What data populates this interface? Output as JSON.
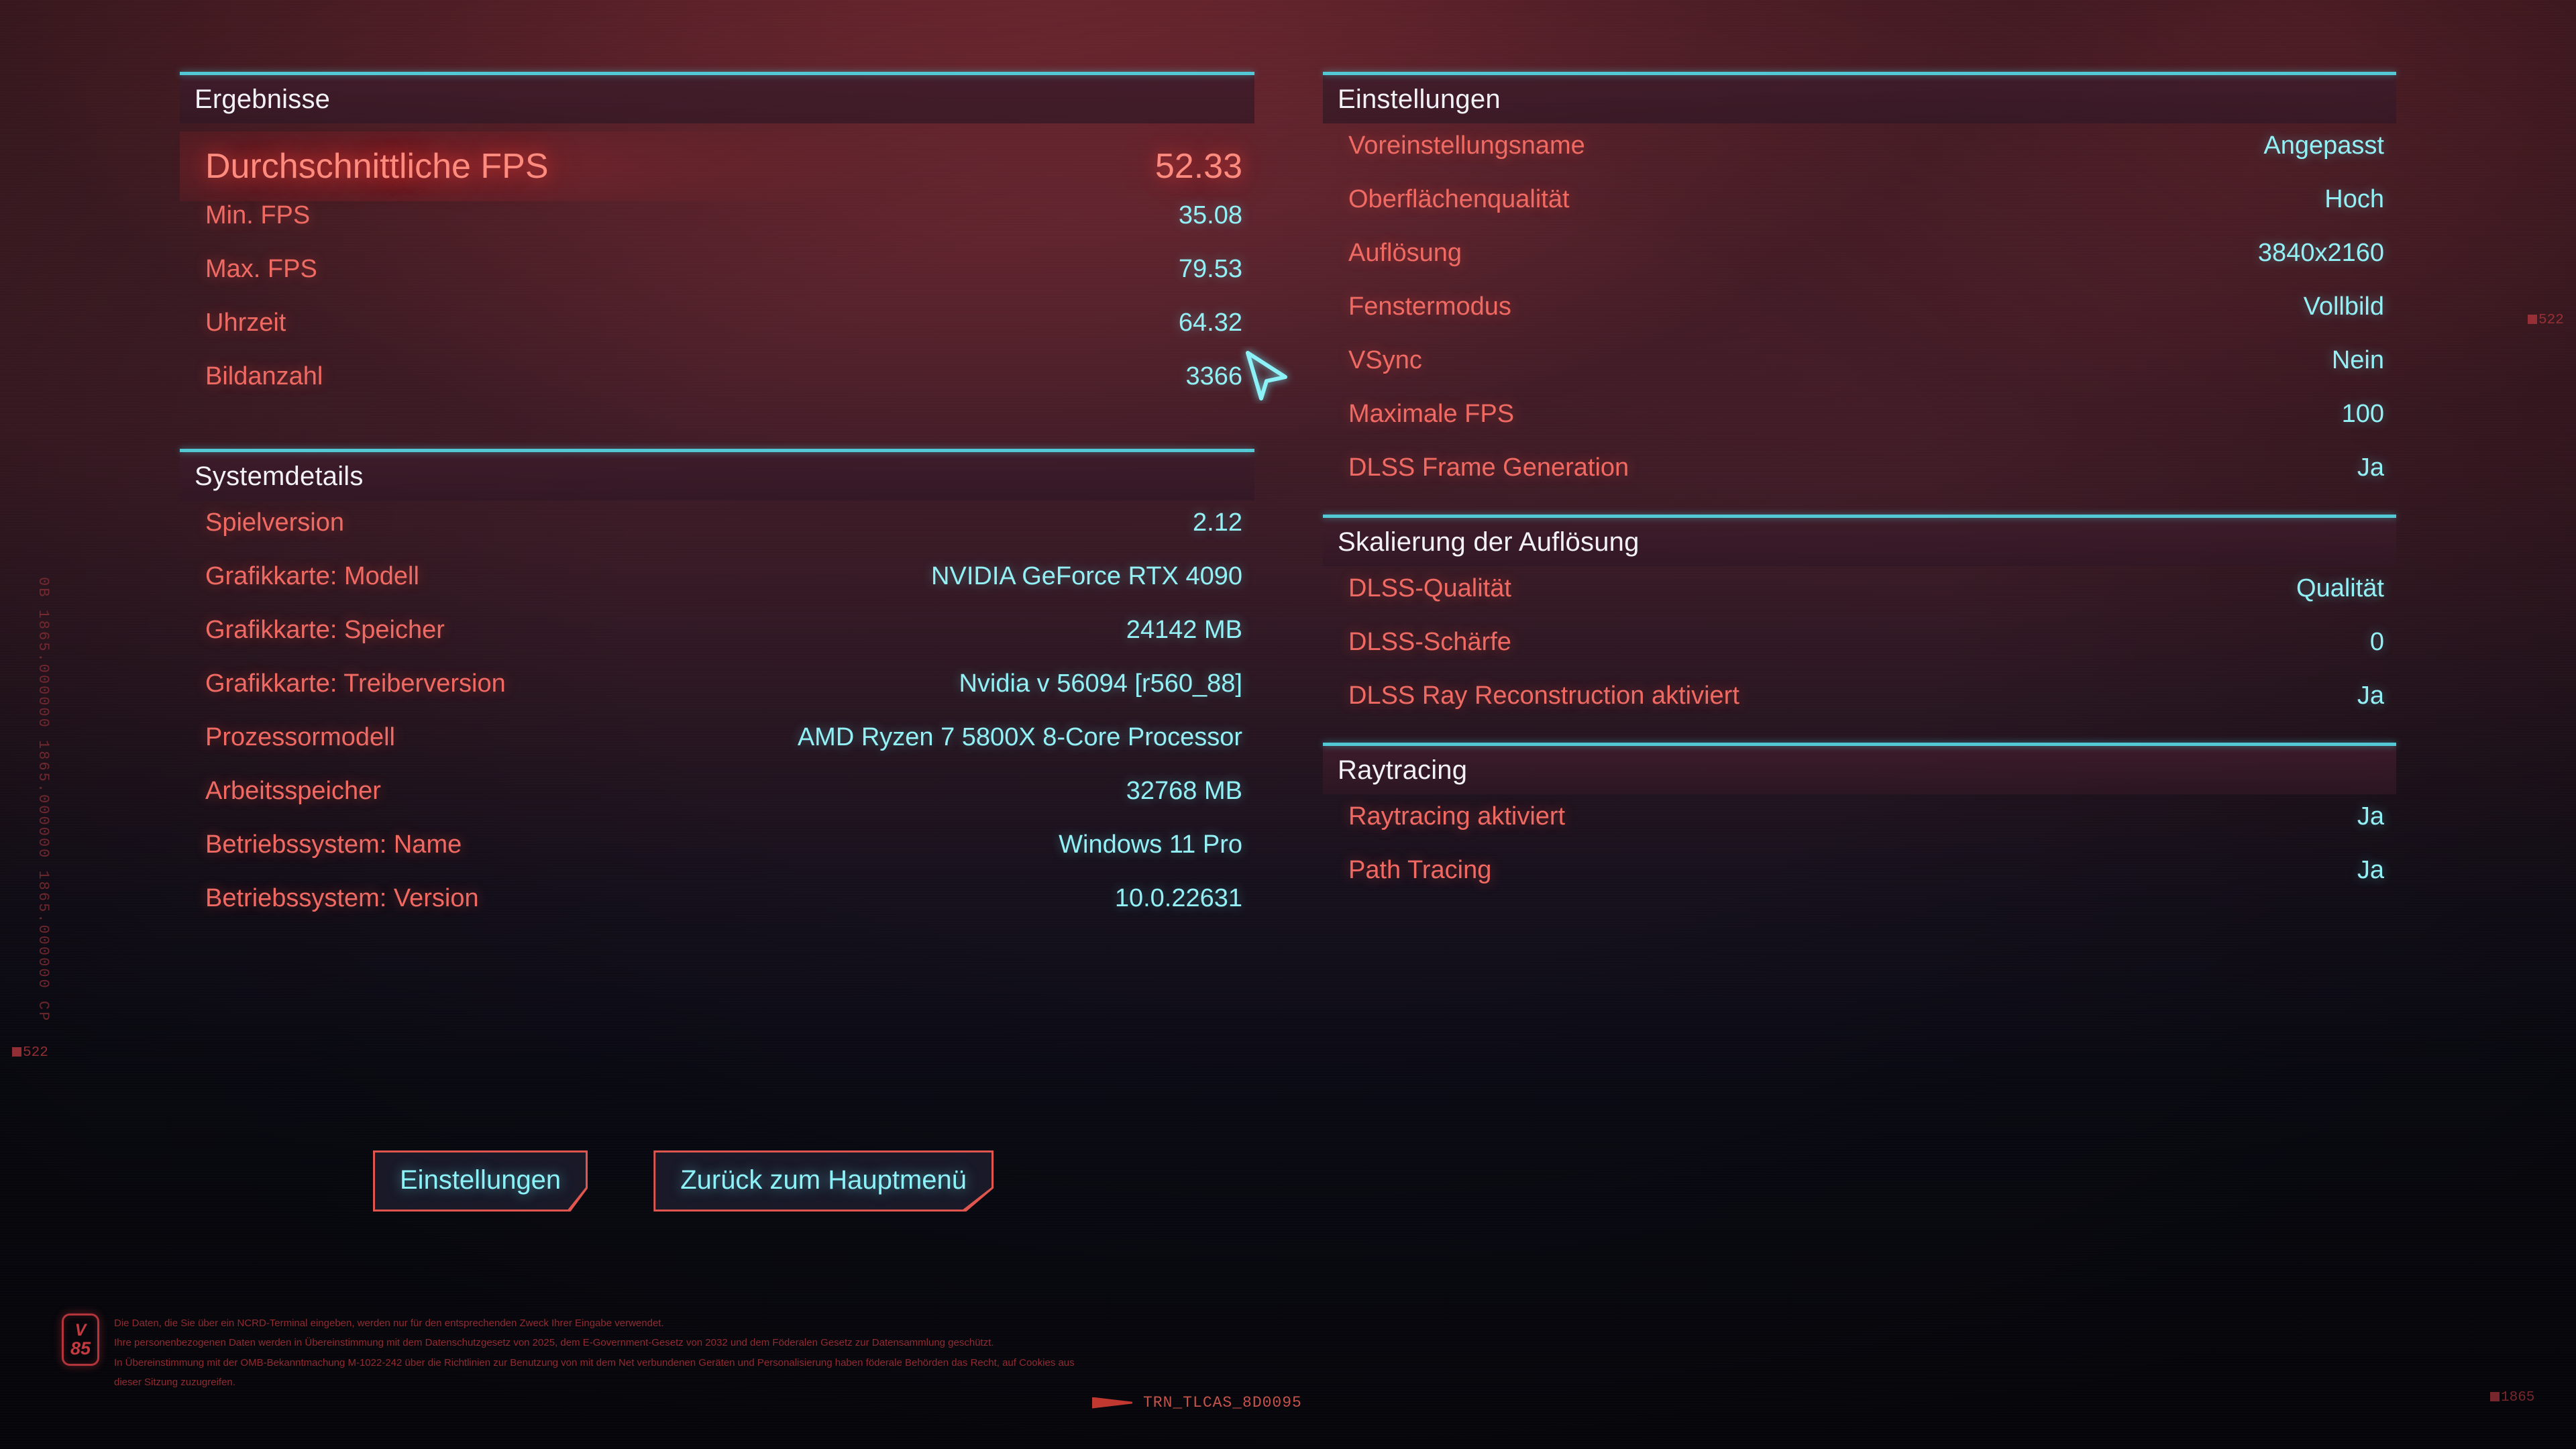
{
  "theme": {
    "accent_cyan": "#54c9d6",
    "value_cyan": "#93f0f5",
    "label_red": "#ef6a62",
    "highlight_red": "#ff8b7e",
    "button_border": "#e0564f",
    "heading_white": "#f2f2f6",
    "background_top": "#5c2831",
    "background_bottom": "#08080f"
  },
  "panels": {
    "results": {
      "title": "Ergebnisse",
      "rows": [
        {
          "label": "Durchschnittliche FPS",
          "value": "52.33",
          "featured": true
        },
        {
          "label": "Min. FPS",
          "value": "35.08"
        },
        {
          "label": "Max. FPS",
          "value": "79.53"
        },
        {
          "label": "Uhrzeit",
          "value": "64.32"
        },
        {
          "label": "Bildanzahl",
          "value": "3366"
        }
      ]
    },
    "system_details": {
      "title": "Systemdetails",
      "rows": [
        {
          "label": "Spielversion",
          "value": "2.12"
        },
        {
          "label": "Grafikkarte: Modell",
          "value": "NVIDIA GeForce RTX 4090"
        },
        {
          "label": "Grafikkarte: Speicher",
          "value": "24142 MB"
        },
        {
          "label": "Grafikkarte: Treiberversion",
          "value": "Nvidia v 56094 [r560_88]"
        },
        {
          "label": "Prozessormodell",
          "value": "AMD Ryzen 7 5800X 8-Core Processor"
        },
        {
          "label": "Arbeitsspeicher",
          "value": "32768 MB"
        },
        {
          "label": "Betriebssystem: Name",
          "value": "Windows 11 Pro"
        },
        {
          "label": "Betriebssystem: Version",
          "value": "10.0.22631"
        }
      ]
    },
    "settings": {
      "title": "Einstellungen",
      "rows": [
        {
          "label": "Voreinstellungsname",
          "value": "Angepasst"
        },
        {
          "label": "Oberflächenqualität",
          "value": "Hoch"
        },
        {
          "label": "Auflösung",
          "value": "3840x2160"
        },
        {
          "label": "Fenstermodus",
          "value": "Vollbild"
        },
        {
          "label": "VSync",
          "value": "Nein"
        },
        {
          "label": "Maximale FPS",
          "value": "100"
        },
        {
          "label": "DLSS Frame Generation",
          "value": "Ja"
        }
      ]
    },
    "resolution_scaling": {
      "title": "Skalierung der Auflösung",
      "rows": [
        {
          "label": "DLSS-Qualität",
          "value": "Qualität"
        },
        {
          "label": "DLSS-Schärfe",
          "value": "0"
        },
        {
          "label": "DLSS Ray Reconstruction aktiviert",
          "value": "Ja"
        }
      ]
    },
    "raytracing": {
      "title": "Raytracing",
      "rows": [
        {
          "label": "Raytracing aktiviert",
          "value": "Ja"
        },
        {
          "label": "Path Tracing",
          "value": "Ja"
        }
      ]
    }
  },
  "buttons": [
    {
      "label": "Einstellungen"
    },
    {
      "label": "Zurück zum Hauptmenü"
    }
  ],
  "decorations": {
    "marker_right": "522",
    "marker_left": "522",
    "marker_bottom": "1865",
    "vertical_code": "0B 1865.000000 1865.000000 1865.000000 CP",
    "footer_code": "TRN_TLCAS_8D0095",
    "badge": {
      "top": "V",
      "bottom": "85"
    },
    "legal": [
      "Die Daten, die Sie über ein NCRD-Terminal eingeben, werden nur für den entsprechenden Zweck Ihrer Eingabe verwendet.",
      "Ihre personenbezogenen Daten werden in Übereinstimmung mit dem Datenschutzgesetz von 2025, dem E-Government-Gesetz von 2032 und dem Föderalen Gesetz zur Datensammlung geschützt.",
      "In Übereinstimmung mit der OMB-Bekanntmachung M-1022-242 über die Richtlinien zur Benutzung von mit dem Net verbundenen Geräten und Personalisierung haben föderale Behörden das Recht, auf Cookies aus",
      "dieser Sitzung zuzugreifen."
    ]
  }
}
